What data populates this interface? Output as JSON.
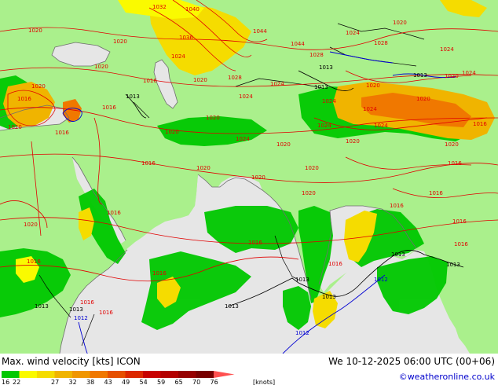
{
  "title": {
    "left": "Max. wind velocity [kts] ICON",
    "right": "We 10-12-2025 06:00 UTC (00+06)"
  },
  "credit": "©weatheronline.co.uk",
  "legend": {
    "unit": "[knots]",
    "ticks": [
      "16",
      "22",
      "27",
      "32",
      "38",
      "43",
      "49",
      "54",
      "59",
      "65",
      "70",
      "76"
    ],
    "colors": [
      "#00c800",
      "#fafa00",
      "#f5dc00",
      "#f0b400",
      "#f09600",
      "#f07800",
      "#e65000",
      "#dc2800",
      "#c80000",
      "#b40000",
      "#960000",
      "#780000",
      "#ff5050"
    ]
  },
  "map": {
    "colors": {
      "land": "#aaf08c",
      "sea": "#e6e6e6",
      "isobar_high": "#e10000",
      "isobar_low": "#0000d2",
      "coast": "#6e6e6e",
      "border": "#000000"
    },
    "isobar_labels": [
      {
        "text": "1032",
        "color": "red"
      },
      {
        "text": "1040",
        "color": "red"
      },
      {
        "text": "1036",
        "color": "red"
      },
      {
        "text": "1044",
        "color": "red"
      },
      {
        "text": "1024",
        "color": "red"
      },
      {
        "text": "1020",
        "color": "red"
      },
      {
        "text": "1028",
        "color": "red"
      },
      {
        "text": "1016",
        "color": "red"
      },
      {
        "text": "1013",
        "color": "black"
      },
      {
        "text": "1012",
        "color": "blue"
      }
    ]
  }
}
